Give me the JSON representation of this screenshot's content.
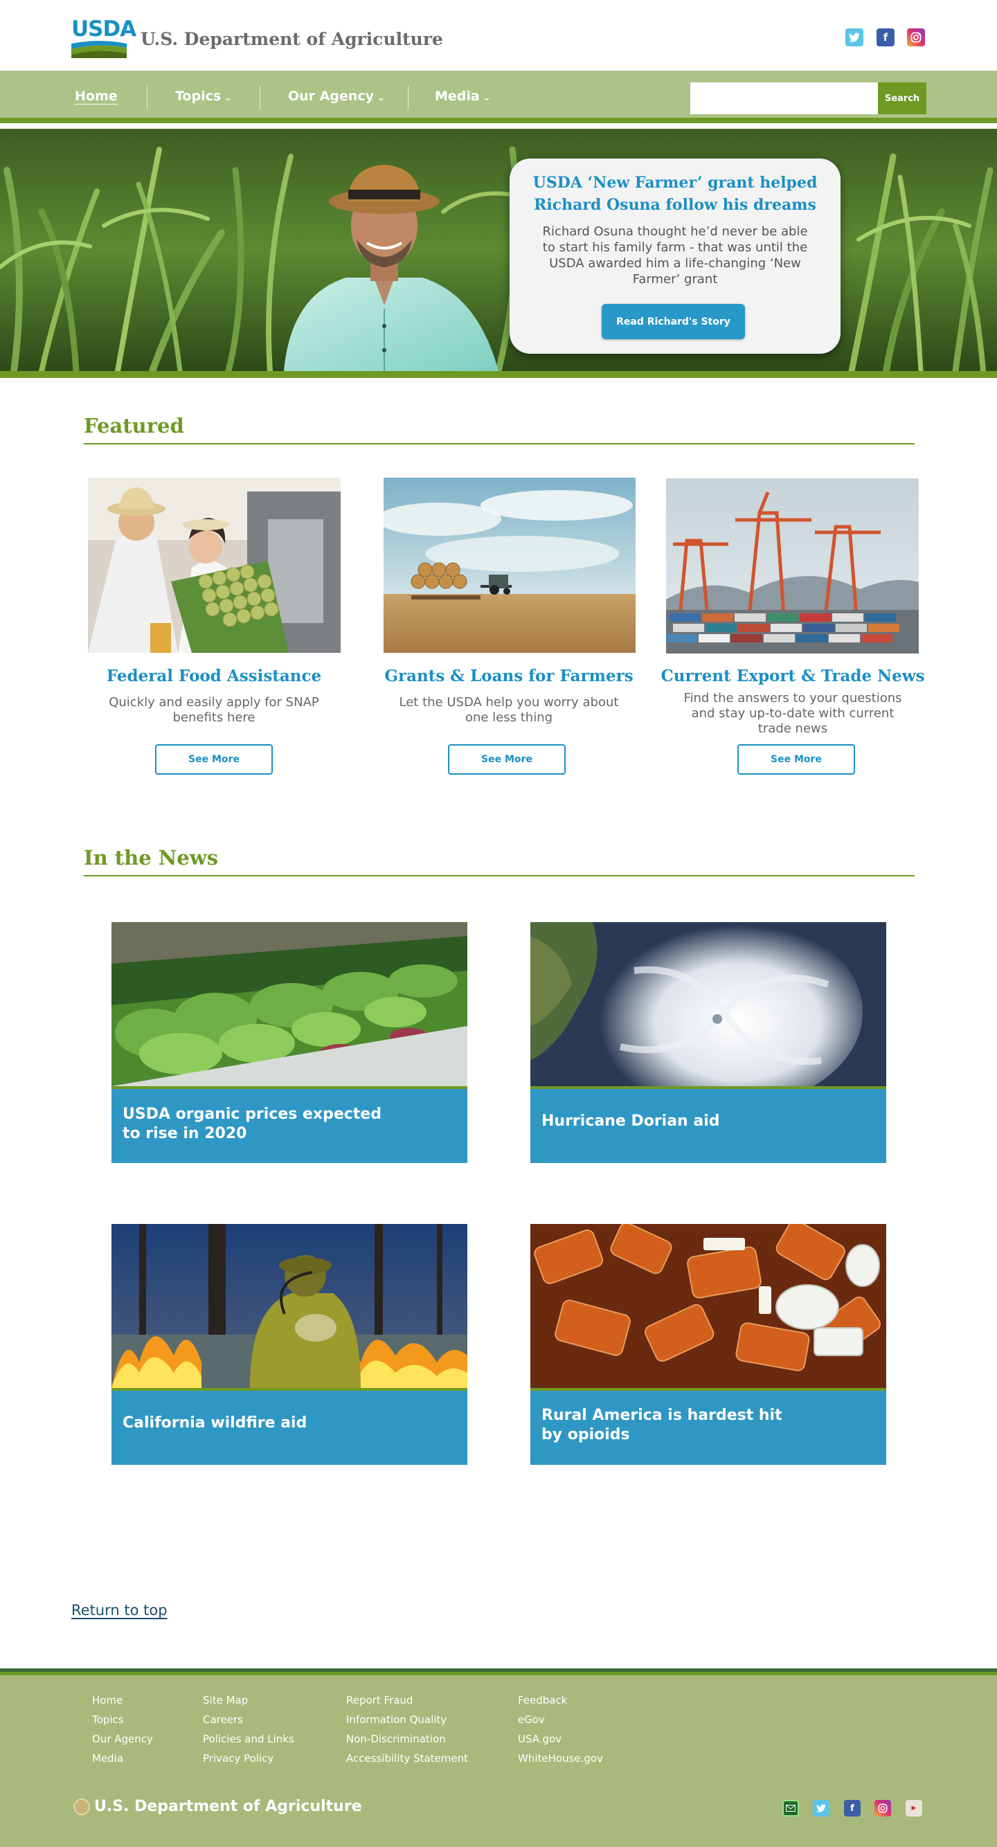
{
  "header": {
    "logo_text": "USDA",
    "title": "U.S. Department of Agriculture"
  },
  "nav": {
    "items": [
      {
        "label": "Home"
      },
      {
        "label": "Topics"
      },
      {
        "label": "Our Agency"
      },
      {
        "label": "Media"
      }
    ],
    "search_button": "Search",
    "search_value": ""
  },
  "hero": {
    "title": "USDA ‘New Farmer’ grant helped Richard Osuna follow his dreams",
    "body": "Richard Osuna thought he’d never be able to start his family farm - that was until the USDA awarded him a life-changing ‘New Farmer’ grant",
    "button": "Read Richard's Story"
  },
  "featured": {
    "heading": "Featured",
    "cards": [
      {
        "title": "Federal Food Assistance",
        "desc": "Quickly and easily apply for SNAP benefits here",
        "button": "See More"
      },
      {
        "title": "Grants & Loans for Farmers",
        "desc": "Let the USDA help you worry about one less thing",
        "button": "See More"
      },
      {
        "title": "Current Export & Trade News",
        "desc": "Find the answers to your questions and stay up-to-date with current trade news",
        "button": "See More"
      }
    ]
  },
  "news": {
    "heading": "In the News",
    "items": [
      {
        "title": "USDA organic prices expected to rise in 2020"
      },
      {
        "title": "Hurricane Dorian aid"
      },
      {
        "title": "California wildfire aid"
      },
      {
        "title": "Rural America is hardest hit by opioids"
      }
    ]
  },
  "return_top": "Return to top",
  "footer": {
    "col1": [
      "Home",
      "Topics",
      "Our Agency",
      "Media"
    ],
    "col2": [
      "Site Map",
      "Careers",
      "Policies and Links",
      "Privacy Policy"
    ],
    "col3": [
      "Report Fraud",
      "Information Quality",
      "Non-Discrimination",
      "Accessibility Statement"
    ],
    "col4": [
      "Feedback",
      "eGov",
      "USA.gov",
      "WhiteHouse.gov"
    ],
    "title": "U.S. Department of Agriculture"
  },
  "colors": {
    "brand_green": "#6e9a24",
    "nav_green": "#adc287",
    "brand_blue": "#1a8fc4",
    "footer_green": "#a9b97b"
  },
  "icons": {
    "social_top": [
      "twitter-icon",
      "facebook-icon",
      "instagram-icon"
    ],
    "social_footer": [
      "email-icon",
      "twitter-icon",
      "facebook-icon",
      "instagram-icon",
      "youtube-icon"
    ]
  }
}
